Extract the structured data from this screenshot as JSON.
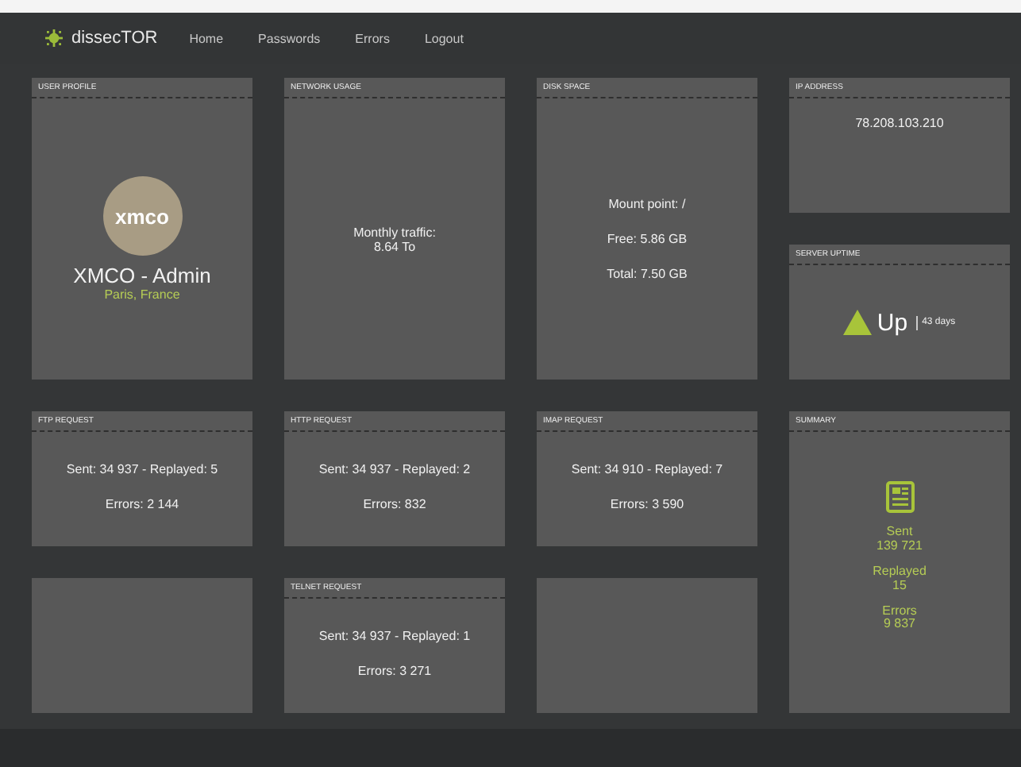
{
  "nav": {
    "brand": "dissecTOR",
    "links": [
      "Home",
      "Passwords",
      "Errors",
      "Logout"
    ]
  },
  "panels": [
    {
      "kind": "profile",
      "title": "USER PROFILE",
      "logo": "xmco",
      "name": "XMCO - Admin",
      "location": "Paris, France"
    },
    {
      "kind": "text",
      "title": "NETWORK USAGE",
      "lines": [
        "Monthly traffic:",
        "8.64 To"
      ]
    },
    {
      "kind": "list",
      "title": "DISK SPACE",
      "lines": [
        "Mount point: /",
        "Free: 5.86 GB",
        "Total: 7.50 GB"
      ]
    },
    {
      "kind": "ip",
      "title": "IP ADDRESS",
      "value": "78.208.103.210"
    },
    {
      "kind": "uptime",
      "title": "SERVER UPTIME",
      "status": "Up",
      "duration": "43 days"
    },
    {
      "kind": "request",
      "title": "FTP REQUEST",
      "lines": [
        "Sent: 34 937 - Replayed: 5",
        "Errors: 2 144"
      ]
    },
    {
      "kind": "request",
      "title": "HTTP REQUEST",
      "lines": [
        "Sent: 34 937 - Replayed: 2",
        "Errors: 832"
      ]
    },
    {
      "kind": "request",
      "title": "IMAP REQUEST",
      "lines": [
        "Sent: 34 910 - Replayed: 7",
        "Errors: 3 590"
      ]
    },
    {
      "kind": "summary",
      "title": "SUMMARY",
      "stats": [
        {
          "label": "Sent",
          "value": "139 721"
        },
        {
          "label": "Replayed",
          "value": "15"
        },
        {
          "label": "Errors",
          "value": "9 837"
        }
      ]
    },
    {
      "kind": "empty"
    },
    {
      "kind": "request",
      "title": "TELNET REQUEST",
      "lines": [
        "Sent: 34 937 - Replayed: 1",
        "Errors: 3 271"
      ]
    },
    {
      "kind": "empty"
    }
  ]
}
